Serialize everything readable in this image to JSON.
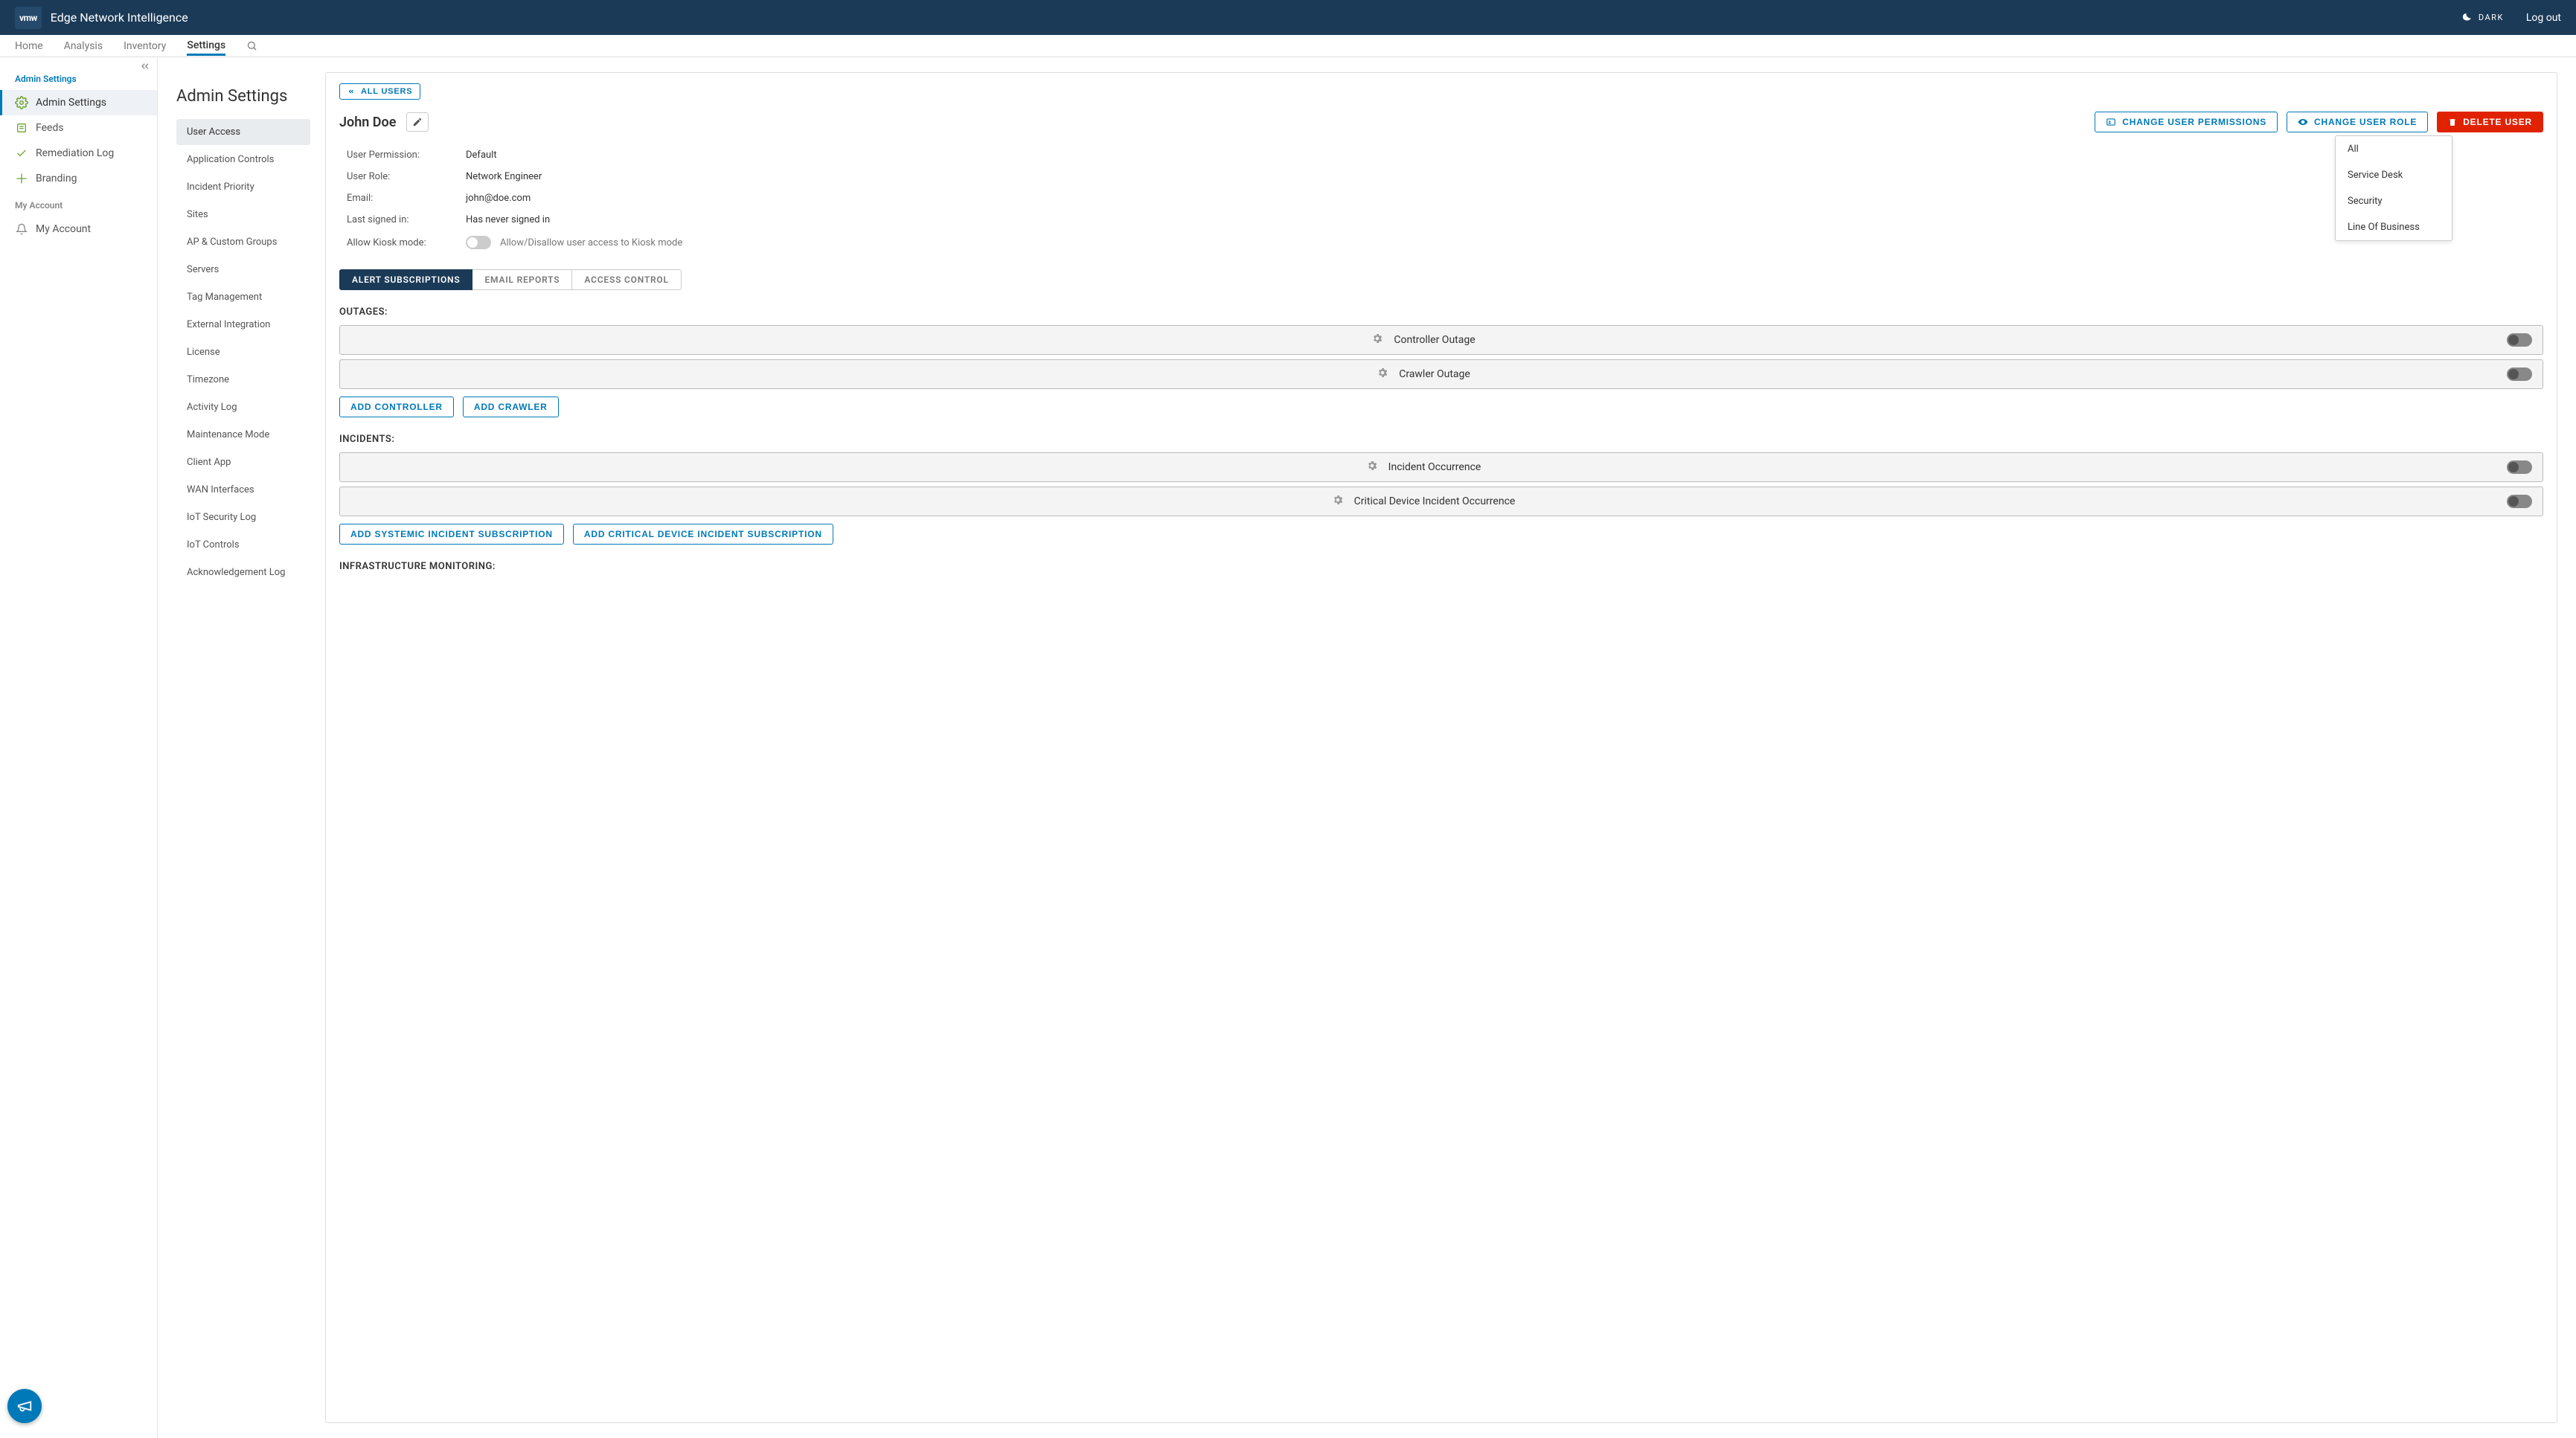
{
  "header": {
    "logo": "vmw",
    "title": "Edge Network Intelligence",
    "dark_label": "DARK",
    "logout": "Log out"
  },
  "topnav": {
    "items": [
      "Home",
      "Analysis",
      "Inventory",
      "Settings"
    ],
    "active": "Settings"
  },
  "sidebar": {
    "section1": "Admin Settings",
    "items1": [
      "Admin Settings",
      "Feeds",
      "Remediation Log",
      "Branding"
    ],
    "section2": "My Account",
    "items2": [
      "My Account"
    ]
  },
  "subnav": {
    "title": "Admin Settings",
    "items": [
      "User Access",
      "Application Controls",
      "Incident Priority",
      "Sites",
      "AP & Custom Groups",
      "Servers",
      "Tag Management",
      "External Integration",
      "License",
      "Timezone",
      "Activity Log",
      "Maintenance Mode",
      "Client App",
      "WAN Interfaces",
      "IoT Security Log",
      "IoT Controls",
      "Acknowledgement Log"
    ]
  },
  "panel": {
    "all_users_btn": "ALL USERS",
    "user_name": "John Doe",
    "change_perm_btn": "CHANGE USER PERMISSIONS",
    "change_role_btn": "CHANGE USER ROLE",
    "delete_btn": "DELETE USER",
    "details": {
      "perm_label": "User Permission:",
      "perm_value": "Default",
      "role_label": "User Role:",
      "role_value": "Network Engineer",
      "email_label": "Email:",
      "email_value": "john@doe.com",
      "signed_label": "Last signed in:",
      "signed_value": "Has never signed in",
      "kiosk_label": "Allow Kiosk mode:",
      "kiosk_help": "Allow/Disallow user access to Kiosk mode"
    },
    "tabs": [
      "ALERT SUBSCRIPTIONS",
      "EMAIL REPORTS",
      "ACCESS CONTROL"
    ],
    "section_outages": "OUTAGES:",
    "outage_rows": [
      "Controller Outage",
      "Crawler Outage"
    ],
    "add_controller_btn": "ADD CONTROLLER",
    "add_crawler_btn": "ADD CRAWLER",
    "section_incidents": "INCIDENTS:",
    "incident_rows": [
      "Incident Occurrence",
      "Critical Device Incident Occurrence"
    ],
    "add_systemic_btn": "ADD SYSTEMIC INCIDENT SUBSCRIPTION",
    "add_critical_btn": "ADD CRITICAL DEVICE INCIDENT SUBSCRIPTION",
    "section_infra": "INFRASTRUCTURE MONITORING:"
  },
  "role_dropdown": [
    "All",
    "Service Desk",
    "Security",
    "Line Of Business"
  ]
}
